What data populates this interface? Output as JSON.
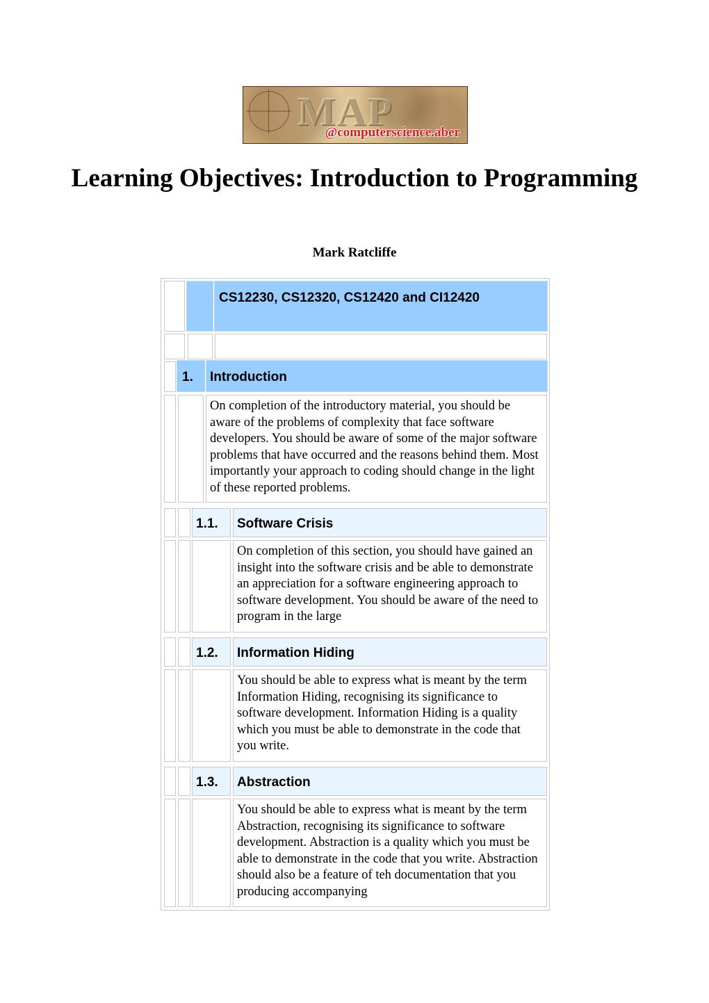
{
  "banner": {
    "logo_letters": "MAP",
    "domain_text": "@computerscience.aber"
  },
  "document": {
    "title": "Learning Objectives: Introduction to Programming",
    "author": "Mark Ratcliffe"
  },
  "colors": {
    "header_blue": "#99ccff",
    "subheader_blue": "#e8f4ff",
    "border_gray": "#c8c8c8"
  },
  "table": {
    "module_header": "CS12230, CS12320, CS12420 and CI12420",
    "sections": [
      {
        "number": "1.",
        "title": "Introduction",
        "body": "On completion of the introductory material, you should be aware of the problems of complexity that face software developers. You should be aware of some of the major software problems that have occurred and the reasons behind them. Most importantly your approach to coding should change in the light of these reported problems."
      },
      {
        "number": "1.1.",
        "title": "Software Crisis",
        "body": "On completion of this section, you should have gained an insight into the software crisis and be able to demonstrate an appreciation for a software engineering approach to software development. You should be aware of the need to program in the large"
      },
      {
        "number": "1.2.",
        "title": "Information Hiding",
        "body": "You should be able to express what is meant by the term Information Hiding, recognising its significance to software development. Information Hiding is a quality which you must be able to demonstrate in the code that you write."
      },
      {
        "number": "1.3.",
        "title": "Abstraction",
        "body": "You should be able to express what is meant by the term Abstraction, recognising its significance to software development. Abstraction is a quality which you must be able to demonstrate in the code that you write. Abstraction should also be a feature of teh documentation that you producing accompanying"
      }
    ]
  }
}
